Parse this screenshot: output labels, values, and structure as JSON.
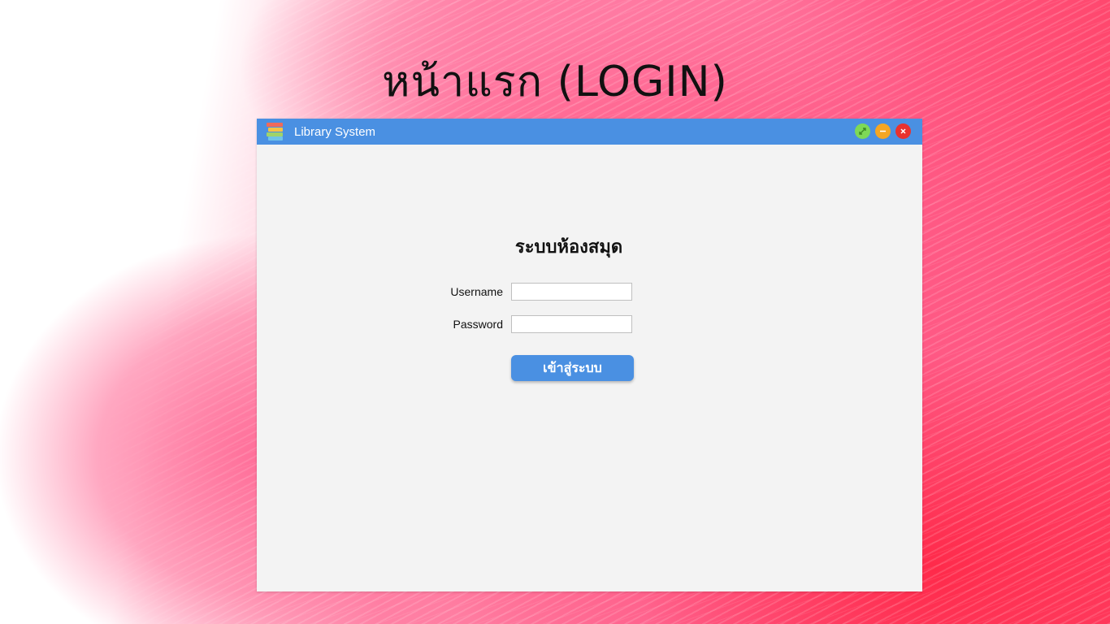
{
  "slide": {
    "title": "หน้าแรก (LOGIN)"
  },
  "window": {
    "app_icon": "books-icon",
    "title": "Library System",
    "controls": {
      "maximize_icon": "expand-icon",
      "maximize_color": "#7ed957",
      "minimize_icon": "minus-icon",
      "minimize_color": "#f5a623",
      "close_icon": "close-icon",
      "close_color": "#e8322e"
    },
    "titlebar_color": "#4a90e2"
  },
  "login_form": {
    "heading": "ระบบห้องสมุด",
    "username_label": "Username",
    "username_value": "",
    "password_label": "Password",
    "password_value": "",
    "submit_label": "เข้าสู่ระบบ"
  }
}
